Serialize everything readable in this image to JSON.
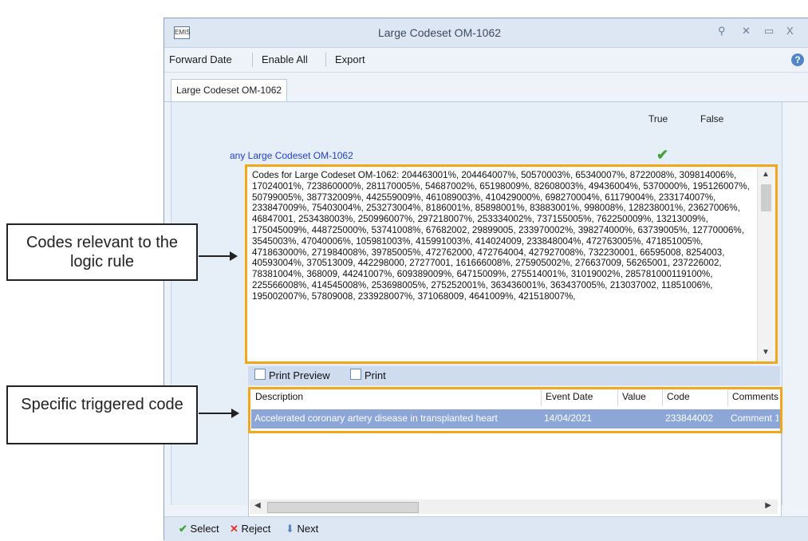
{
  "window": {
    "title": "Large Codeset OM-1062",
    "app_icon": "EMIS"
  },
  "toolbar": {
    "forward_date": "Forward Date",
    "enable_all": "Enable All",
    "export": "Export",
    "help": "?"
  },
  "tab": {
    "label": "Large Codeset OM-1062"
  },
  "columns": {
    "true_label": "True",
    "false_label": "False"
  },
  "rule": {
    "label": "any Large Codeset OM-1062",
    "result_icon": "green-check-icon"
  },
  "codes_text": "Codes for  Large Codeset OM-1062: 204463001%, 204464007%, 50570003%, 65340007%, 8722008%, 309814006%, 17024001%, 723860000%, 281170005%, 54687002%, 65198009%, 82608003%, 49436004%, 5370000%, 195126007%, 50799005%, 387732009%, 442559009%, 461089003%, 410429000%, 698270004%, 61179004%, 233174007%, 233847009%, 75403004%, 253273004%, 8186001%, 85898001%, 83883001%, 998008%, 128238001%, 23627006%, 46847001, 253438003%, 250996007%, 297218007%, 253334002%, 737155005%, 762250009%, 13213009%, 175045009%, 448725000%, 53741008%, 67682002, 29899005, 233970002%, 398274000%, 63739005%, 12770006%, 3545003%, 47040006%, 105981003%, 415991003%, 414024009, 233848004%, 472763005%, 471851005%, 471863000%, 271984008%, 39785005%, 472762000, 472764004, 427927008%, 732230001, 66595008, 8254003, 40593004%, 370513009, 442298000, 27277001, 161666008%, 275905002%, 276637009, 56265001, 237226002, 78381004%, 368009, 44241007%, 609389009%, 64715009%, 275514001%, 31019002%, 285781000119100%, 225566008%, 414545008%, 253698005%, 275252001%, 363436001%, 363437005%, 213037002, 11851006%, 195002007%, 57809008, 233928007%, 371068009, 4641009%, 421518007%,",
  "print_bar": {
    "print_preview": "Print Preview",
    "print": "Print"
  },
  "grid": {
    "headers": [
      "Description",
      "Event Date",
      "Value",
      "Code",
      "Comments"
    ],
    "rows": [
      [
        "Accelerated coronary artery disease in transplanted heart",
        "14/04/2021",
        "",
        "233844002",
        "Comment 1"
      ]
    ]
  },
  "statusbar": {
    "select": "Select",
    "reject": "Reject",
    "next": "Next"
  },
  "callouts": {
    "codes": "Codes relevant to the logic rule",
    "triggered": "Specific triggered code"
  },
  "colors": {
    "highlight": "#f2a71b",
    "row_selected": "#8da6d8",
    "link_blue": "#1f3fd0"
  }
}
